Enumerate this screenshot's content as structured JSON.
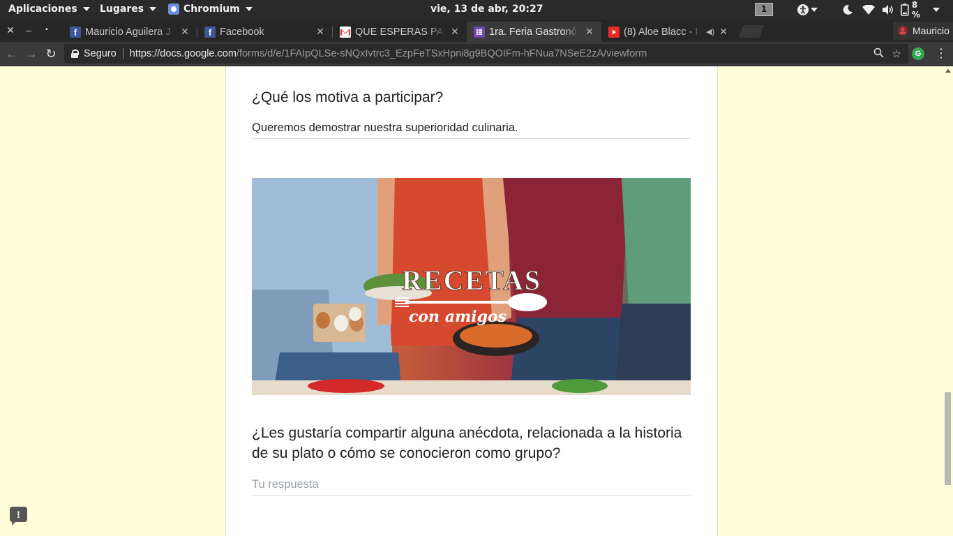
{
  "topbar": {
    "apps_label": "Aplicaciones",
    "places_label": "Lugares",
    "app_name": "Chromium",
    "clock": "vie, 13 de abr, 20:27",
    "workspace": "1",
    "battery": "8 %"
  },
  "tabs": [
    {
      "title": "Mauricio Aguilera J",
      "favicon": "facebook-icon"
    },
    {
      "title": "Facebook",
      "favicon": "facebook-icon"
    },
    {
      "title": "QUE ESPERAS PAR",
      "favicon": "gmail-icon"
    },
    {
      "title": "1ra. Feria Gastronó",
      "favicon": "google-forms-icon"
    },
    {
      "title": "(8) Aloe Blacc - I",
      "favicon": "youtube-icon"
    }
  ],
  "profile_name": "Mauricio",
  "address_bar": {
    "security_label": "Seguro",
    "url_host": "https://docs.google.com",
    "url_path": "/forms/d/e/1FAIpQLSe-sNQxIvtrc3_EzpFeTSxHpni8g9BQOIFm-hFNua7NSeE2zA/viewform"
  },
  "form": {
    "q1": {
      "title": "¿Qué los motiva a participar?",
      "answer": "Queremos demostrar nuestra superioridad culinaria."
    },
    "image": {
      "title_text": "RECETAS",
      "subtitle_text": "con amigos"
    },
    "q2": {
      "title": "¿Les gustaría compartir alguna anécdota, relacionada a la historia de su plato o cómo se conocieron como grupo?",
      "placeholder": "Tu respuesta"
    }
  },
  "colors": {
    "page_background": "#fffed8",
    "card_background": "#ffffff",
    "top_panel": "#2a2a2a",
    "toolbar": "#3a3a3a"
  }
}
